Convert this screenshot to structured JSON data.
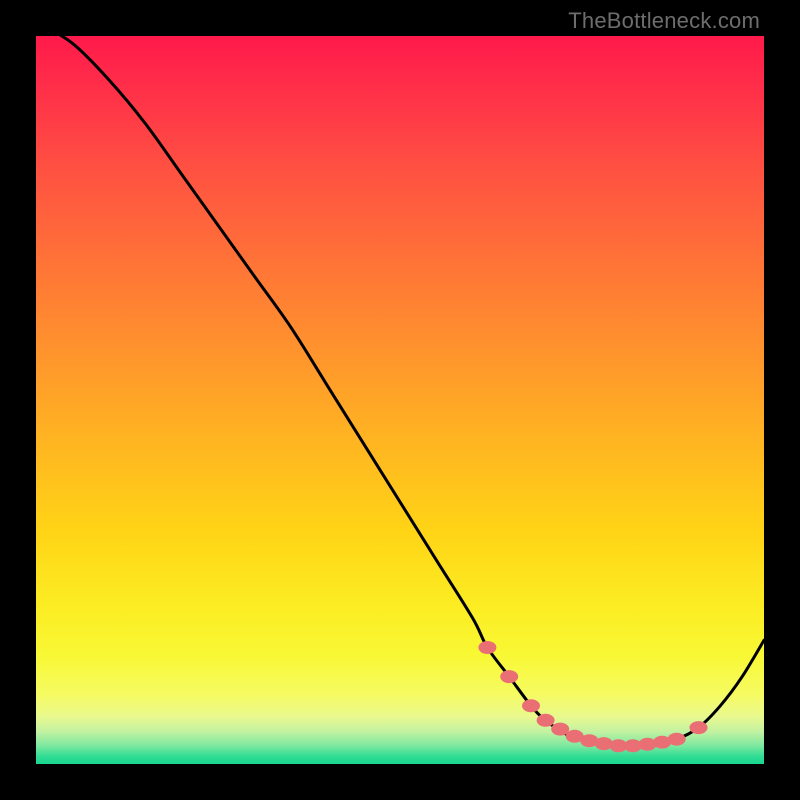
{
  "watermark": "TheBottleneck.com",
  "gradient_stops": [
    {
      "offset": 0.0,
      "color": "#ff1a4b"
    },
    {
      "offset": 0.07,
      "color": "#ff2e49"
    },
    {
      "offset": 0.18,
      "color": "#ff5042"
    },
    {
      "offset": 0.3,
      "color": "#ff7038"
    },
    {
      "offset": 0.42,
      "color": "#ff902e"
    },
    {
      "offset": 0.55,
      "color": "#ffb322"
    },
    {
      "offset": 0.68,
      "color": "#ffd416"
    },
    {
      "offset": 0.78,
      "color": "#fcec22"
    },
    {
      "offset": 0.85,
      "color": "#f8f834"
    },
    {
      "offset": 0.905,
      "color": "#f6fb62"
    },
    {
      "offset": 0.935,
      "color": "#e9f98f"
    },
    {
      "offset": 0.955,
      "color": "#c4f2a1"
    },
    {
      "offset": 0.975,
      "color": "#7de8a0"
    },
    {
      "offset": 0.99,
      "color": "#2fdc94"
    },
    {
      "offset": 1.0,
      "color": "#17d78e"
    }
  ],
  "dot_color": "#e96f74",
  "curve_color": "#000000",
  "chart_data": {
    "type": "line",
    "title": "",
    "xlabel": "",
    "ylabel": "",
    "xlim": [
      0,
      100
    ],
    "ylim": [
      0,
      100
    ],
    "grid": false,
    "series": [
      {
        "name": "bottleneck-curve",
        "x": [
          0,
          5,
          10,
          15,
          20,
          25,
          30,
          35,
          40,
          45,
          50,
          55,
          60,
          62,
          65,
          68,
          70,
          73,
          76,
          79,
          82,
          85,
          88,
          91,
          94,
          97,
          100
        ],
        "y": [
          102,
          99,
          94,
          88,
          81,
          74,
          67,
          60,
          52,
          44,
          36,
          28,
          20,
          16,
          12,
          8,
          6,
          4,
          3,
          2.5,
          2.5,
          2.8,
          3.4,
          5,
          8,
          12,
          17
        ]
      }
    ],
    "marker_points": {
      "name": "highlight-dots",
      "x": [
        62,
        65,
        68,
        70,
        72,
        74,
        76,
        78,
        80,
        82,
        84,
        86,
        88,
        91
      ],
      "y": [
        16,
        12,
        8,
        6,
        4.8,
        3.8,
        3.2,
        2.8,
        2.5,
        2.5,
        2.7,
        3.0,
        3.4,
        5.0
      ]
    }
  }
}
